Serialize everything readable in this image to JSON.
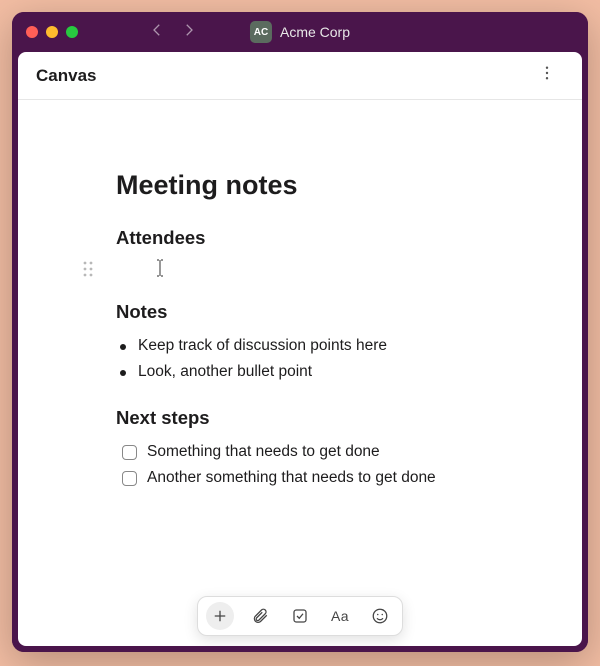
{
  "workspace": {
    "logo_text": "AC",
    "name": "Acme Corp"
  },
  "canvas": {
    "header_title": "Canvas"
  },
  "doc": {
    "title": "Meeting notes",
    "sections": {
      "attendees": {
        "heading": "Attendees"
      },
      "notes": {
        "heading": "Notes",
        "bullets": [
          "Keep track of discussion points here",
          "Look, another bullet point"
        ]
      },
      "next_steps": {
        "heading": "Next steps",
        "items": [
          {
            "text": "Something that needs to get done",
            "checked": false
          },
          {
            "text": "Another something that needs to get done",
            "checked": false
          }
        ]
      }
    }
  },
  "toolbar": {
    "text_format_label": "Aa"
  }
}
